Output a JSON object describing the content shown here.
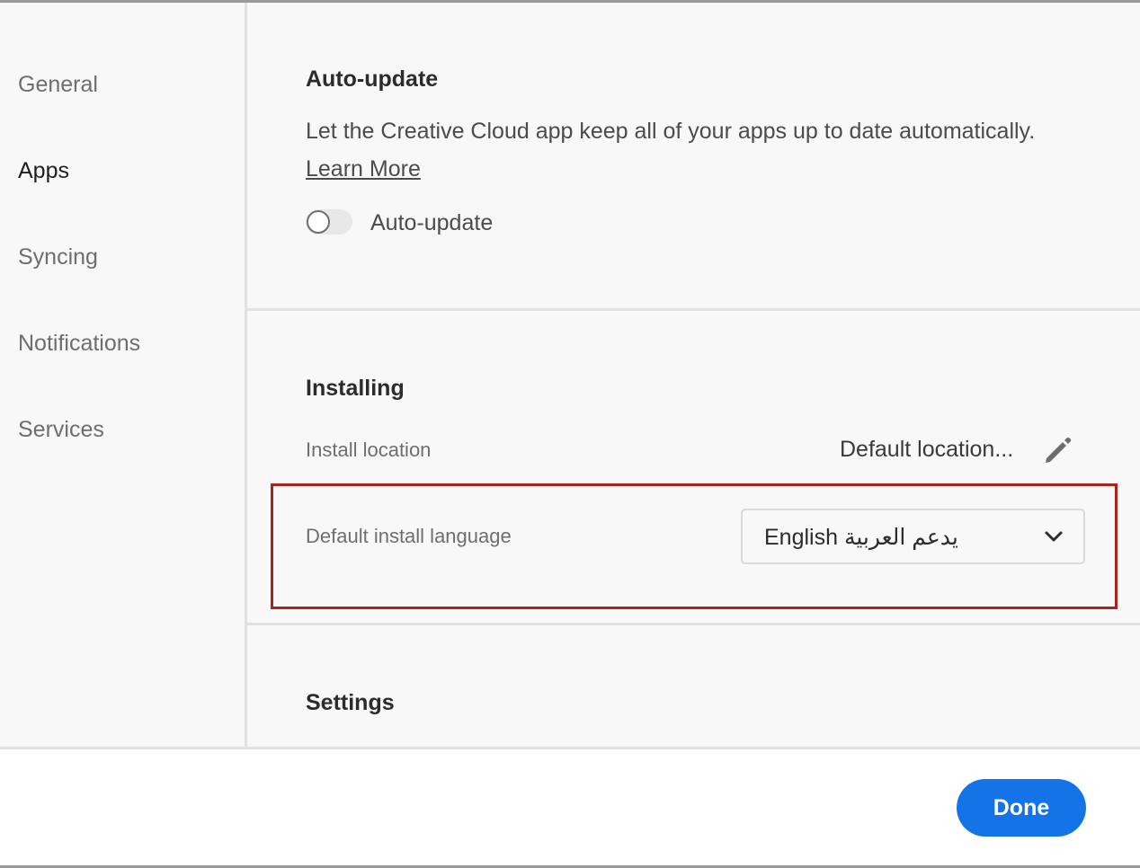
{
  "sidebar": {
    "items": [
      {
        "label": "General",
        "active": false
      },
      {
        "label": "Apps",
        "active": true
      },
      {
        "label": "Syncing",
        "active": false
      },
      {
        "label": "Notifications",
        "active": false
      },
      {
        "label": "Services",
        "active": false
      }
    ]
  },
  "auto_update": {
    "title": "Auto-update",
    "description": "Let the Creative Cloud app keep all of your apps up to date automatically.",
    "learn_more": "Learn More",
    "toggle_label": "Auto-update",
    "toggle_on": false
  },
  "installing": {
    "title": "Installing",
    "install_location_label": "Install location",
    "install_location_value": "Default location...",
    "language_label": "Default install language",
    "language_value": "English يدعم العربية"
  },
  "settings": {
    "title": "Settings"
  },
  "footer": {
    "done_label": "Done"
  },
  "colors": {
    "accent": "#1473e6",
    "highlight_border": "#a8241c",
    "background": "#f8f8f8"
  },
  "icons": {
    "edit": "pencil-icon",
    "dropdown": "chevron-down-icon"
  }
}
